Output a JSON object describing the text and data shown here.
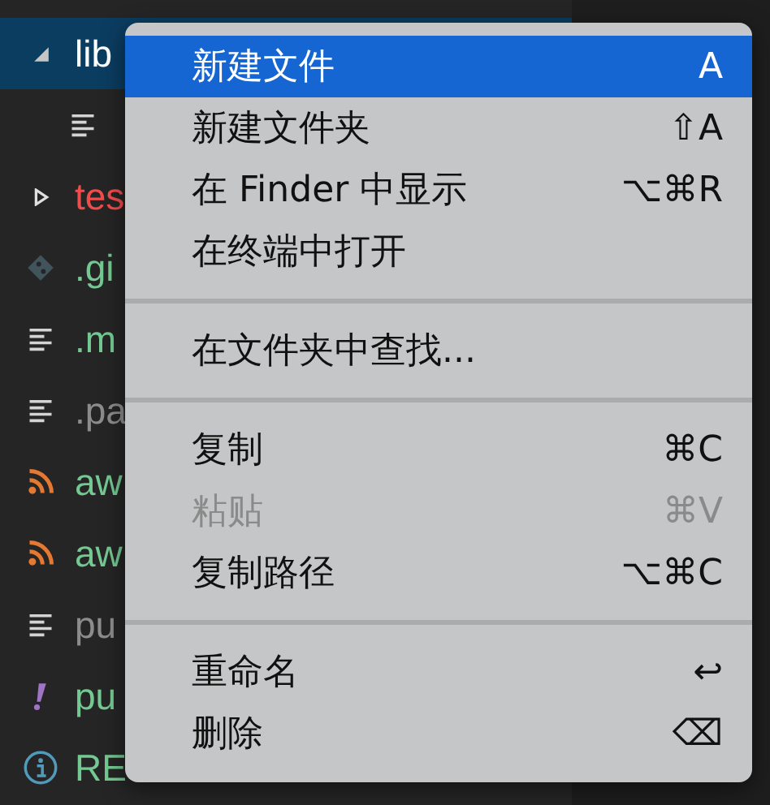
{
  "explorer": {
    "items": [
      {
        "kind": "folder",
        "name": "lib",
        "expanded": true,
        "selected": true,
        "color": "#ffffff",
        "children": [
          {
            "kind": "text"
          }
        ]
      },
      {
        "kind": "folder",
        "name": "tes",
        "expanded": false,
        "selected": false,
        "color": "#f14c4c"
      },
      {
        "kind": "git",
        "name": ".gi",
        "selected": false,
        "color": "#73c991"
      },
      {
        "kind": "text",
        "name": ".m",
        "selected": false,
        "color": "#73c991"
      },
      {
        "kind": "text",
        "name": ".pa",
        "selected": false,
        "color": "#8c8c8c"
      },
      {
        "kind": "feed",
        "name": "aw",
        "selected": false,
        "color": "#73c991"
      },
      {
        "kind": "feed",
        "name": "aw",
        "selected": false,
        "color": "#73c991"
      },
      {
        "kind": "text",
        "name": "pu",
        "selected": false,
        "color": "#8c8c8c"
      },
      {
        "kind": "yaml",
        "name": "pu",
        "selected": false,
        "color": "#73c991"
      },
      {
        "kind": "info",
        "name": "RE",
        "selected": false,
        "color": "#73c991"
      }
    ]
  },
  "context_menu": {
    "groups": [
      [
        {
          "label": "新建文件",
          "shortcut": "A",
          "selected": true,
          "disabled": false
        },
        {
          "label": "新建文件夹",
          "shortcut": "⇧A",
          "selected": false,
          "disabled": false
        },
        {
          "label": "在 Finder 中显示",
          "shortcut": "⌥⌘R",
          "selected": false,
          "disabled": false
        },
        {
          "label": "在终端中打开",
          "selected": false,
          "disabled": false
        }
      ],
      [
        {
          "label": "在文件夹中查找...",
          "selected": false,
          "disabled": false
        }
      ],
      [
        {
          "label": "复制",
          "shortcut": "⌘C",
          "selected": false,
          "disabled": false
        },
        {
          "label": "粘贴",
          "shortcut": "⌘V",
          "selected": false,
          "disabled": true
        },
        {
          "label": "复制路径",
          "shortcut": "⌥⌘C",
          "selected": false,
          "disabled": false
        }
      ],
      [
        {
          "label": "重命名",
          "shortcut": "↩",
          "selected": false,
          "disabled": false
        },
        {
          "label": "删除",
          "shortcut": "⌫",
          "selected": false,
          "disabled": false
        }
      ]
    ]
  }
}
